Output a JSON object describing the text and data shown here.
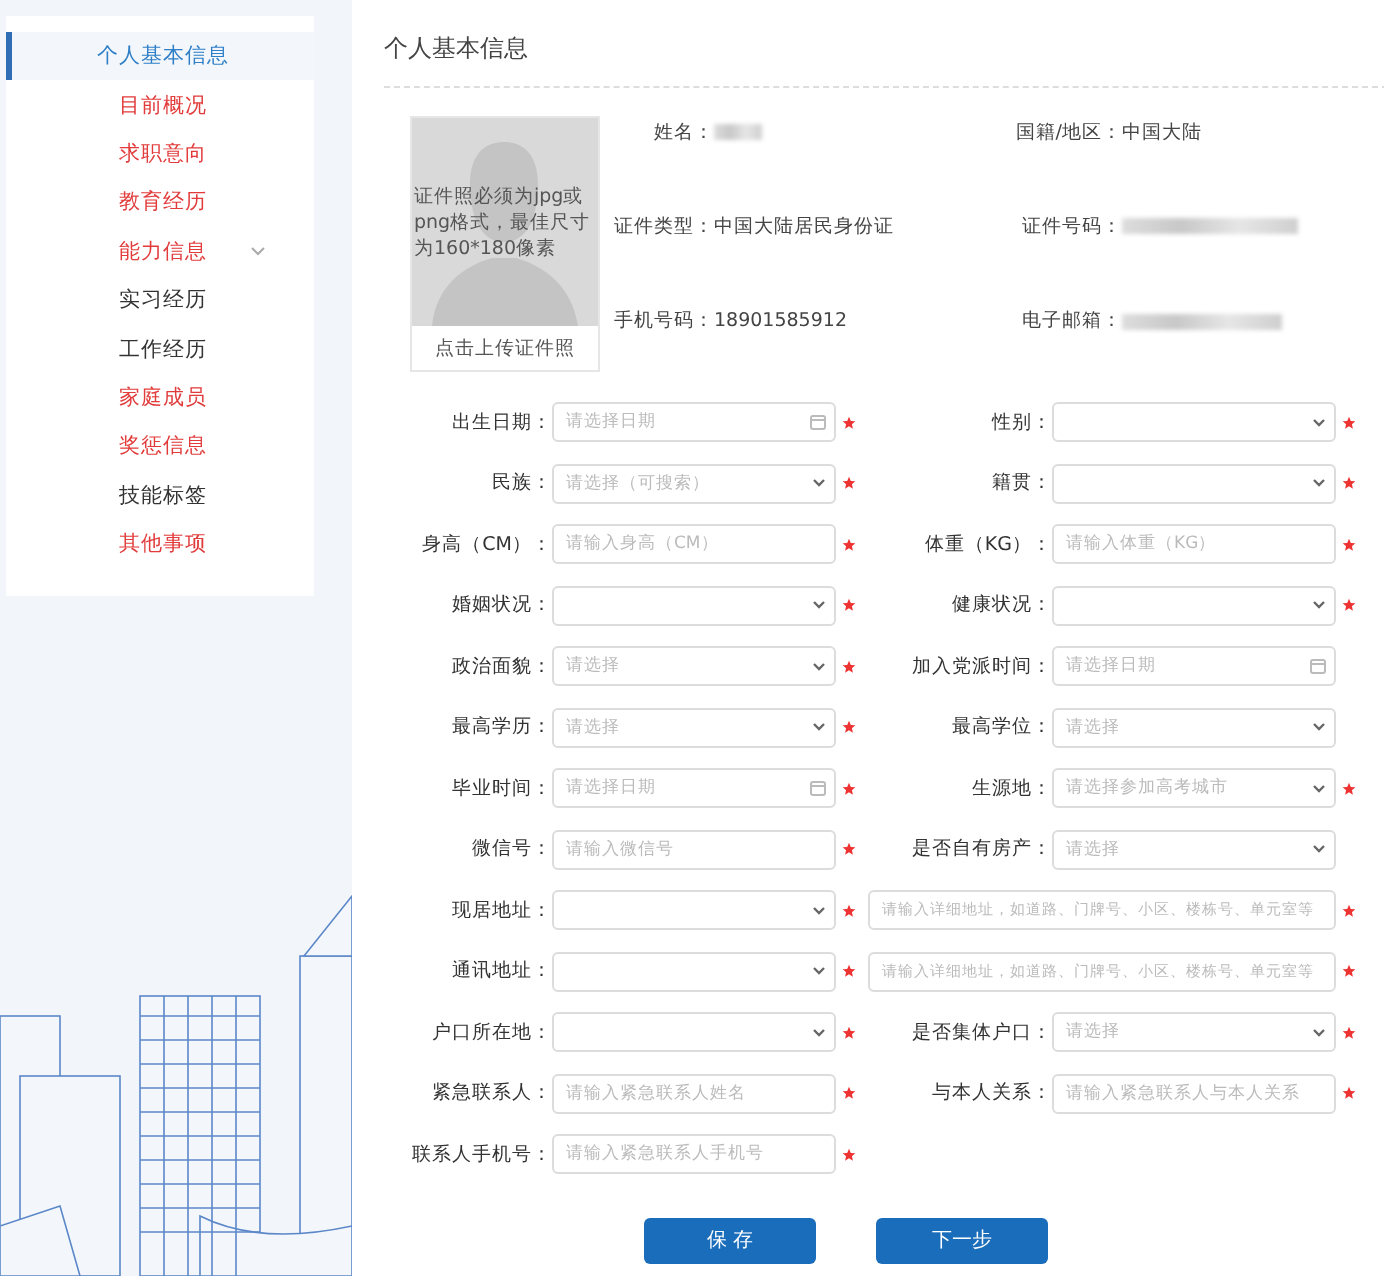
{
  "sidebar": {
    "items": [
      {
        "label": "个人基本信息",
        "selected": true,
        "color": "#2f7fc8",
        "expandable": false
      },
      {
        "label": "目前概况",
        "selected": false,
        "color": "#e23b3b",
        "expandable": false
      },
      {
        "label": "求职意向",
        "selected": false,
        "color": "#e23b3b",
        "expandable": false
      },
      {
        "label": "教育经历",
        "selected": false,
        "color": "#e23b3b",
        "expandable": false
      },
      {
        "label": "能力信息",
        "selected": false,
        "color": "#e23b3b",
        "expandable": true
      },
      {
        "label": "实习经历",
        "selected": false,
        "color": "#333333",
        "expandable": false
      },
      {
        "label": "工作经历",
        "selected": false,
        "color": "#333333",
        "expandable": false
      },
      {
        "label": "家庭成员",
        "selected": false,
        "color": "#e23b3b",
        "expandable": false
      },
      {
        "label": "奖惩信息",
        "selected": false,
        "color": "#e23b3b",
        "expandable": false
      },
      {
        "label": "技能标签",
        "selected": false,
        "color": "#333333",
        "expandable": false
      },
      {
        "label": "其他事项",
        "selected": false,
        "color": "#e23b3b",
        "expandable": false
      }
    ]
  },
  "section_title": "个人基本信息",
  "photo": {
    "hint": "证件照必须为jpg或png格式，最佳尺寸为160*180像素",
    "upload_label": "点击上传证件照"
  },
  "info": [
    {
      "label": "姓名："
    },
    {
      "label": "国籍/地区：",
      "value": "中国大陆"
    },
    {
      "label": "证件类型：",
      "value": "中国大陆居民身份证"
    },
    {
      "label": "证件号码："
    },
    {
      "label": "手机号码：",
      "value": "18901585912"
    },
    {
      "label": "电子邮箱："
    }
  ],
  "form_rows": [
    {
      "left": {
        "label": "出生日期：",
        "kind": "date",
        "placeholder": "请选择日期",
        "required": true
      },
      "right": {
        "label": "性别：",
        "kind": "select",
        "required": true
      }
    },
    {
      "left": {
        "label": "民族：",
        "kind": "select",
        "placeholder": "请选择（可搜索）",
        "required": true
      },
      "right": {
        "label": "籍贯：",
        "kind": "select",
        "required": true
      }
    },
    {
      "left": {
        "label": "身高（CM）：",
        "kind": "text",
        "placeholder": "请输入身高（CM）",
        "required": true
      },
      "right": {
        "label": "体重（KG）：",
        "kind": "text",
        "placeholder": "请输入体重（KG）",
        "required": true
      }
    },
    {
      "left": {
        "label": "婚姻状况：",
        "kind": "select",
        "required": true
      },
      "right": {
        "label": "健康状况：",
        "kind": "select",
        "required": true
      }
    },
    {
      "left": {
        "label": "政治面貌：",
        "kind": "select",
        "placeholder": "请选择",
        "required": true
      },
      "right": {
        "label": "加入党派时间：",
        "kind": "date",
        "placeholder": "请选择日期",
        "required": false
      }
    },
    {
      "left": {
        "label": "最高学历：",
        "kind": "select",
        "placeholder": "请选择",
        "required": true
      },
      "right": {
        "label": "最高学位：",
        "kind": "select",
        "placeholder": "请选择",
        "required": false
      }
    },
    {
      "left": {
        "label": "毕业时间：",
        "kind": "date",
        "placeholder": "请选择日期",
        "required": true
      },
      "right": {
        "label": "生源地：",
        "kind": "select",
        "placeholder": "请选择参加高考城市",
        "required": true
      }
    },
    {
      "left": {
        "label": "微信号：",
        "kind": "text",
        "placeholder": "请输入微信号",
        "required": true
      },
      "right": {
        "label": "是否自有房产：",
        "kind": "select",
        "placeholder": "请选择",
        "required": false
      }
    },
    {
      "left": {
        "label": "现居地址：",
        "kind": "select",
        "required": true
      },
      "right": {
        "kind": "wide",
        "placeholder": "请输入详细地址，如道路、门牌号、小区、楼栋号、单元室等",
        "required": true
      }
    },
    {
      "left": {
        "label": "通讯地址：",
        "kind": "select",
        "required": true
      },
      "right": {
        "kind": "wide",
        "placeholder": "请输入详细地址，如道路、门牌号、小区、楼栋号、单元室等",
        "required": true
      }
    },
    {
      "left": {
        "label": "户口所在地：",
        "kind": "select",
        "required": true
      },
      "right": {
        "label": "是否集体户口：",
        "kind": "select",
        "placeholder": "请选择",
        "required": true
      }
    },
    {
      "left": {
        "label": "紧急联系人：",
        "kind": "text",
        "placeholder": "请输入紧急联系人姓名",
        "required": true
      },
      "right": {
        "label": "与本人关系：",
        "kind": "text",
        "placeholder": "请输入紧急联系人与本人关系",
        "required": true
      }
    },
    {
      "left": {
        "label": "联系人手机号：",
        "kind": "text",
        "placeholder": "请输入紧急联系人手机号",
        "required": true
      },
      "right": null
    }
  ],
  "buttons": [
    "保 存",
    "下一步"
  ]
}
